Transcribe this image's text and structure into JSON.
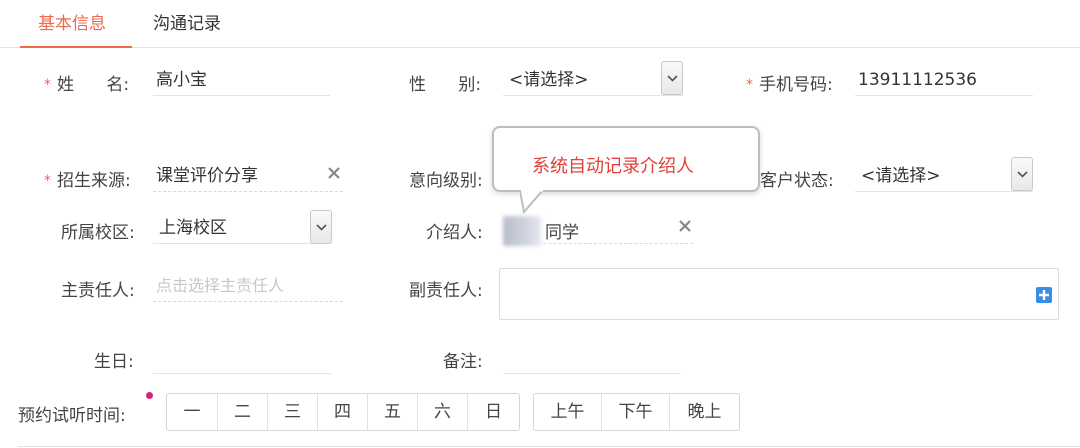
{
  "tabs": [
    {
      "label": "基本信息",
      "active": true
    },
    {
      "label": "沟通记录",
      "active": false
    }
  ],
  "form": {
    "name": {
      "label": "姓      名:",
      "value": "高小宝",
      "required": true
    },
    "gender": {
      "label": "性      别:",
      "value": "<请选择>"
    },
    "phone": {
      "label": "手机号码:",
      "value": "13911112536",
      "required": true
    },
    "source": {
      "label": "招生来源:",
      "value": "课堂评价分享",
      "required": true
    },
    "intent_level": {
      "label": "意向级别:"
    },
    "customer_status": {
      "label": "客户状态:",
      "value": "<请选择>"
    },
    "campus": {
      "label": "所属校区:",
      "value": "上海校区"
    },
    "referrer": {
      "label": "介绍人:",
      "value": "同学"
    },
    "owner": {
      "label": "主责任人:",
      "placeholder": "点击选择主责任人"
    },
    "co_owner": {
      "label": "副责任人:"
    },
    "birthday": {
      "label": "生日:"
    },
    "remark": {
      "label": "备注:"
    },
    "trial_time": {
      "label": "预约试听时间:",
      "days": [
        "一",
        "二",
        "三",
        "四",
        "五",
        "六",
        "日"
      ],
      "periods": [
        "上午",
        "下午",
        "晚上"
      ]
    }
  },
  "tooltip": {
    "text": "系统自动记录介绍人"
  },
  "colors": {
    "accent": "#f0694c",
    "tooltip_text": "#e2403a",
    "plus": "#3a8ee6",
    "dot": "#d6217a"
  },
  "icons": {
    "select": "chevron-down-icon",
    "clear": "close-icon",
    "add": "plus-icon"
  }
}
